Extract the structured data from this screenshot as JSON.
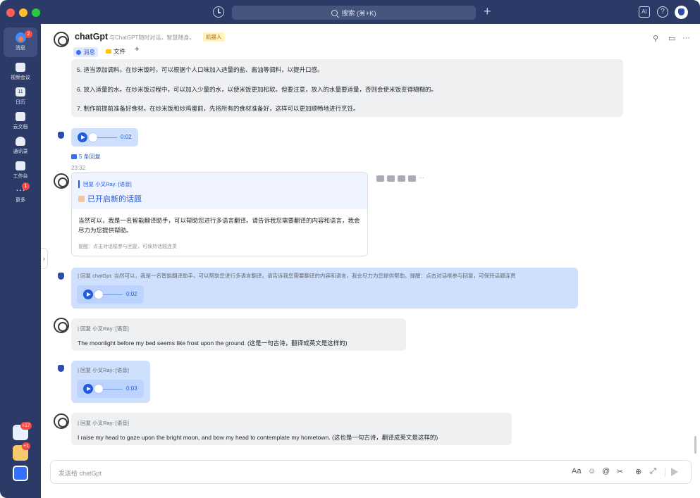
{
  "titlebar": {
    "search_label": "搜索 (⌘+K)",
    "plus": "+",
    "help": "?",
    "ai": "AI"
  },
  "sidebar": {
    "items": [
      {
        "label": "消息",
        "badge": "2"
      },
      {
        "label": "视频会议"
      },
      {
        "label": "日历",
        "icon_text": "11"
      },
      {
        "label": "云文档"
      },
      {
        "label": "通讯录"
      },
      {
        "label": "工作台"
      },
      {
        "label": "更多",
        "badge": "1"
      }
    ],
    "app_badges": [
      "+17",
      "+1"
    ]
  },
  "chat": {
    "title": "chatGpt",
    "description": "与ChatGPT随时对话，智慧随身。",
    "bot_tag": "机器人",
    "tabs": [
      {
        "label": "消息"
      },
      {
        "label": "文件"
      },
      {
        "label": "+"
      }
    ],
    "header_more": "···"
  },
  "messages": {
    "list_lines": [
      "5. 适当添加调料。在炒米饭时，可以根据个人口味加入适量的盐、酱油等调料，以提升口感。",
      "6. 放入适量的水。在炒米饭过程中，可以加入少量的水，以使米饭更加松软。但要注意，放入的水量要适量，否则会使米饭变得糊糊的。",
      "7. 制作前提前准备好食材。在炒米饭和炒鸡蛋前，先将所有的食材准备好，这样可以更加顺畅地进行烹饪。"
    ],
    "voice1_duration": "0:02",
    "replies_count": "5 条回复",
    "timestamp": "23:32",
    "card": {
      "quote": "回复 小叉Ray: [语音]",
      "title": "已开启新的话题",
      "body": "当然可以，我是一名智能翻译助手，可以帮助您进行多语言翻译。请告诉我您需要翻译的内容和语言，我会尽力为您提供帮助。",
      "hint": "提醒：点击对话框参与回复，可保持话题连贯",
      "more": "···"
    },
    "user_reply_quote": "| 回复 chatGpt: 当然可以，我是一名智能翻译助手，可以帮助您进行多语言翻译。请告诉我您需要翻译的内容和语言，我会尽力为您提供帮助。提醒：点击对话框参与回复，可保持话题连贯",
    "voice2_duration": "0:02",
    "bot_reply1_quote": "| 回复 小叉Ray: [语音]",
    "bot_reply1_text": "The moonlight before my bed seems like frost upon the ground. (这是一句古诗，翻译成英文是这样的)",
    "user_reply2_quote": "| 回复 小叉Ray: [语音]",
    "voice3_duration": "0:03",
    "bot_reply2_quote": "| 回复 小叉Ray: [语音]",
    "bot_reply2_text": "I raise my head to gaze upon the bright moon, and bow my head to contemplate my hometown. (这也是一句古诗，翻译成英文是这样的)"
  },
  "composer": {
    "placeholder": "发送给 chatGpt",
    "tools": [
      "Aa",
      "☺",
      "@",
      "✂",
      "⊕",
      "⤢"
    ]
  }
}
